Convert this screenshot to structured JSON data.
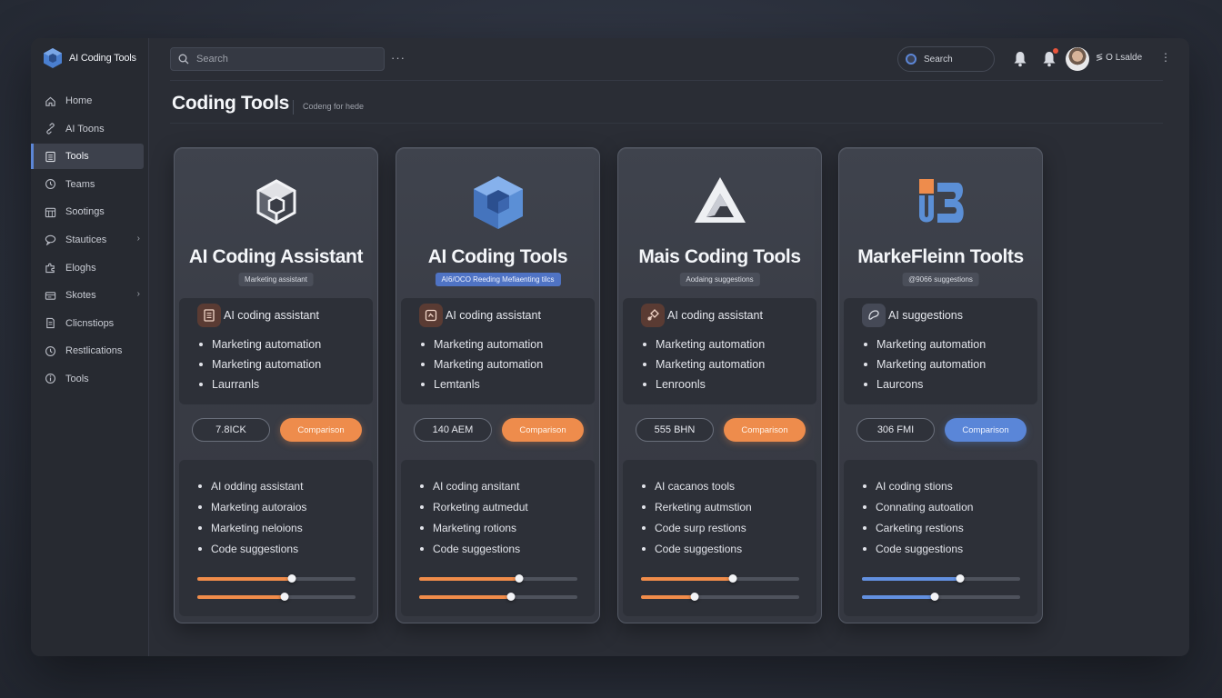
{
  "app": {
    "title": "AI Coding Tools",
    "accent": "#5c86d6",
    "orange": "#ee8c4c"
  },
  "sidebar": {
    "items": [
      {
        "label": "Home",
        "icon": "home-icon",
        "active": false,
        "chevron": false
      },
      {
        "label": "AI Toons",
        "icon": "link-icon",
        "active": false,
        "chevron": false
      },
      {
        "label": "Tools",
        "icon": "grid-icon",
        "active": true,
        "chevron": false
      },
      {
        "label": "Teams",
        "icon": "clock-icon",
        "active": false,
        "chevron": false
      },
      {
        "label": "Sootings",
        "icon": "calendar-icon",
        "active": false,
        "chevron": false
      },
      {
        "label": "Stautices",
        "icon": "chat-icon",
        "active": false,
        "chevron": true
      },
      {
        "label": "Eloghs",
        "icon": "puzzle-icon",
        "active": false,
        "chevron": false
      },
      {
        "label": "Skotes",
        "icon": "layers-icon",
        "active": false,
        "chevron": true
      },
      {
        "label": "Clicnstiops",
        "icon": "document-icon",
        "active": false,
        "chevron": false
      },
      {
        "label": "Restlications",
        "icon": "clock-icon",
        "active": false,
        "chevron": false
      },
      {
        "label": "Tools",
        "icon": "info-icon",
        "active": false,
        "chevron": false
      }
    ]
  },
  "topbar": {
    "search_placeholder": "Search",
    "search_pill_label": "Search",
    "user_name": "≶ O Lsalde"
  },
  "header": {
    "title": "Coding Tools",
    "subtitle": "Codeng for hede"
  },
  "cards": [
    {
      "title": "AI Coding Assistant",
      "tag": "Marketing assistant",
      "tag_style": "grey",
      "icon": "cube-outline-icon",
      "lead_feature": "AI coding assistant",
      "upper_bullets": [
        "Marketing automation",
        "Marketing automation",
        "Laurranls"
      ],
      "metric": "7.8ICK",
      "button": "Comparison",
      "button_style": "orange",
      "lower_bullets": [
        "AI odding assistant",
        "Marketing autoraios",
        "Marketing neloions",
        "Code suggestions"
      ],
      "sliders": [
        0.6,
        0.55
      ],
      "slider_color": "orange"
    },
    {
      "title": "AI Coding Tools",
      "tag": "AI6/OCO Reeding Mefiaenting tilcs",
      "tag_style": "blue",
      "icon": "blue-cube-icon",
      "lead_feature": "AI coding assistant",
      "upper_bullets": [
        "Marketing automation",
        "Marketing automation",
        "Lemtanls"
      ],
      "metric": "140 AEM",
      "button": "Comparison",
      "button_style": "orange",
      "lower_bullets": [
        "AI coding ansitant",
        "Rorketing autmedut",
        "Marketing rotions",
        "Code suggestions"
      ],
      "sliders": [
        0.63,
        0.58
      ],
      "slider_color": "orange"
    },
    {
      "title": "Mais Coding Tools",
      "tag": "Aodaing suggestions",
      "tag_style": "grey",
      "icon": "triangle-logo-icon",
      "lead_feature": "AI coding assistant",
      "upper_bullets": [
        "Marketing automation",
        "Marketing automation",
        "Lenroonls"
      ],
      "metric": "555 BHN",
      "button": "Comparison",
      "button_style": "orange",
      "lower_bullets": [
        "AI cacanos tools",
        "Rerketing autmstion",
        "Code surp restions",
        "Code suggestions"
      ],
      "sliders": [
        0.58,
        0.34
      ],
      "slider_color": "orange"
    },
    {
      "title": "MarkeFleinn Toolts",
      "tag": "@9066 suggestions",
      "tag_style": "grey",
      "icon": "ub-logo-icon",
      "lead_feature": "AI suggestions",
      "upper_bullets": [
        "Marketing automation",
        "Marketing automation",
        "Laurcons"
      ],
      "metric": "306 FMI",
      "button": "Comparison",
      "button_style": "blue",
      "lower_bullets": [
        "AI coding stions",
        "Connating autoation",
        "Carketing restions",
        "Code suggestions"
      ],
      "sliders": [
        0.62,
        0.46
      ],
      "slider_color": "blue"
    }
  ]
}
